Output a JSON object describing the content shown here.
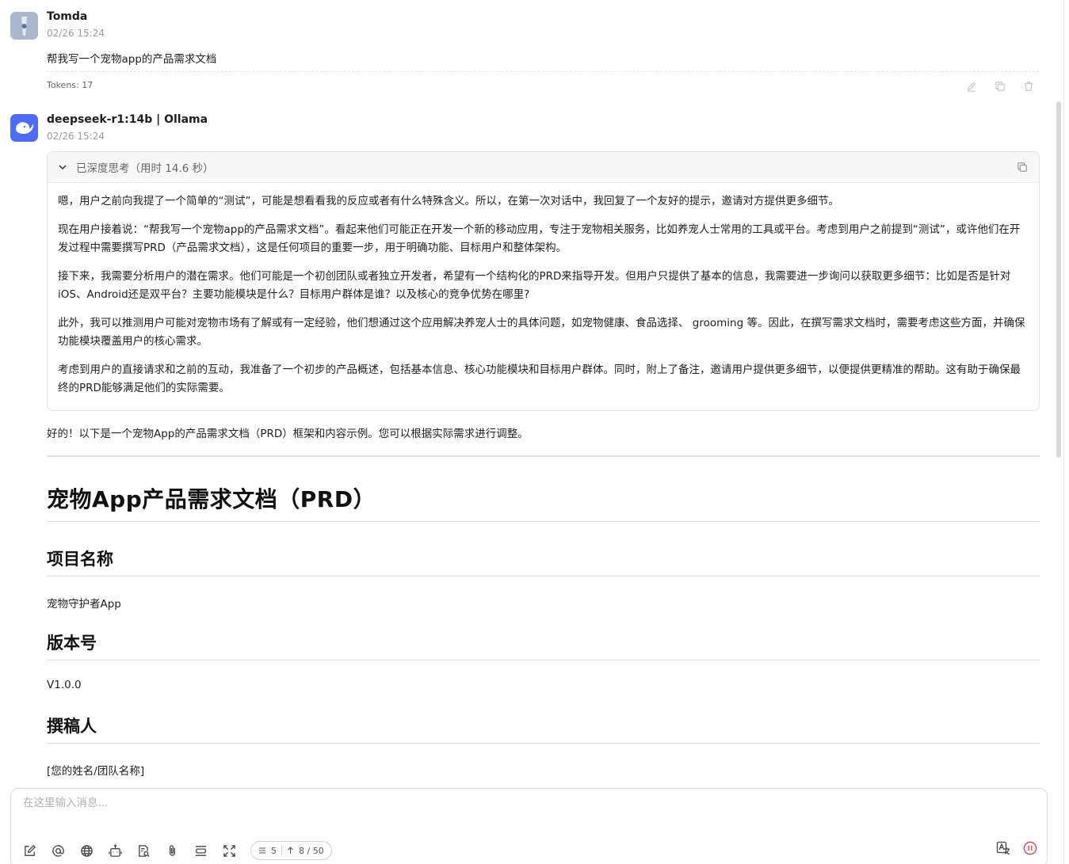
{
  "user_message": {
    "name": "Tomda",
    "time": "02/26 15:24",
    "content": "帮我写一个宠物app的产品需求文档",
    "tokens": "Tokens: 17",
    "icons": [
      "edit-icon",
      "copy-icon",
      "delete-icon"
    ]
  },
  "bot_message": {
    "name": "deepseek-r1:14b | Ollama",
    "time": "02/26 15:24",
    "thinking": {
      "title": "已深度思考（用时 14.6 秒）",
      "paragraphs": [
        "嗯，用户之前向我提了一个简单的“测试”，可能是想看看我的反应或者有什么特殊含义。所以，在第一次对话中，我回复了一个友好的提示，邀请对方提供更多细节。",
        "现在用户接着说：“帮我写一个宠物app的产品需求文档”。看起来他们可能正在开发一个新的移动应用，专注于宠物相关服务，比如养宠人士常用的工具或平台。考虑到用户之前提到“测试”，或许他们在开发过程中需要撰写PRD（产品需求文档），这是任何项目的重要一步，用于明确功能、目标用户和整体架构。",
        "接下来，我需要分析用户的潜在需求。他们可能是一个初创团队或者独立开发者，希望有一个结构化的PRD来指导开发。但用户只提供了基本的信息，我需要进一步询问以获取更多细节：比如是否是针对iOS、Android还是双平台？主要功能模块是什么？目标用户群体是谁？以及核心的竞争优势在哪里?",
        "此外，我可以推测用户可能对宠物市场有了解或有一定经验，他们想通过这个应用解决养宠人士的具体问题，如宠物健康、食品选择、 grooming 等。因此，在撰写需求文档时，需要考虑这些方面，并确保功能模块覆盖用户的核心需求。",
        "考虑到用户的直接请求和之前的互动，我准备了一个初步的产品概述，包括基本信息、核心功能模块和目标用户群体。同时，附上了备注，邀请用户提供更多细节，以便提供更精准的帮助。这有助于确保最终的PRD能够满足他们的实际需要。"
      ]
    },
    "intro": "好的！以下是一个宠物App的产品需求文档（PRD）框架和内容示例。您可以根据实际需求进行调整。",
    "doc": {
      "title": "宠物App产品需求文档（PRD）",
      "sections": [
        {
          "heading": "项目名称",
          "text": "宠物守护者App"
        },
        {
          "heading": "版本号",
          "text": "V1.0.0"
        },
        {
          "heading": "撰稿人",
          "text": "[您的姓名/团队名称]"
        }
      ]
    }
  },
  "composer": {
    "placeholder": "在这里输入消息...",
    "context_count": "5",
    "token_count": "8 / 50",
    "toolbar_icons": [
      "new-topic-icon",
      "mention-icon",
      "web-search-icon",
      "assistant-icon",
      "knowledge-icon",
      "attachment-icon",
      "clear-context-icon",
      "expand-icon"
    ],
    "right_icons": [
      "translate-icon",
      "pause-icon"
    ]
  },
  "colors": {
    "accent_bot": "#4d6bfe",
    "stop_red": "#e5484d"
  }
}
